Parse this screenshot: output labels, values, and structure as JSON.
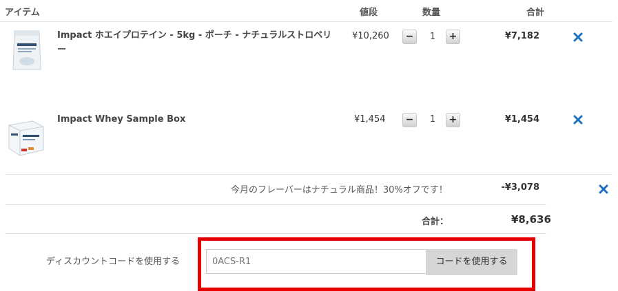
{
  "header": {
    "item": "アイテム",
    "price": "値段",
    "quantity": "数量",
    "total": "合計"
  },
  "items": [
    {
      "name": "Impact ホエイプロテイン - 5kg - ポーチ - ナチュラルストロベリー",
      "price": "¥10,260",
      "qty_minus": "−",
      "qty": "1",
      "qty_plus": "+",
      "total": "¥7,182",
      "image_icon": "protein-pouch-image",
      "remove_icon": "close-icon"
    },
    {
      "name": "Impact Whey Sample Box",
      "price": "¥1,454",
      "qty_minus": "−",
      "qty": "1",
      "qty_plus": "+",
      "total": "¥1,454",
      "image_icon": "sample-box-image",
      "remove_icon": "close-icon"
    }
  ],
  "promo": {
    "text": "今月のフレーバーはナチュラル商品！30%オフです！",
    "amount": "-¥3,078"
  },
  "summary": {
    "label": "合計：",
    "amount": "¥8,636"
  },
  "discount": {
    "label": "ディスカウントコードを使用する",
    "code_value": "0ACS-R1",
    "button_label": "コードを使用する"
  },
  "colors": {
    "remove_icon": "#1e6fc0",
    "highlight_border": "#e60000",
    "button_bg": "#d4d6d8"
  }
}
